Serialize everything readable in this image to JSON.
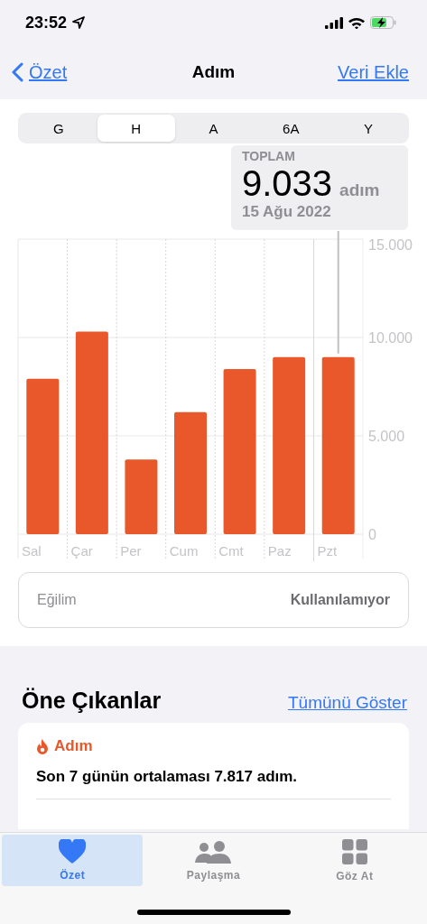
{
  "status_bar": {
    "time": "23:52"
  },
  "nav": {
    "back": "Özet",
    "title": "Adım",
    "action": "Veri Ekle"
  },
  "segments": [
    {
      "label": "G",
      "selected": false
    },
    {
      "label": "H",
      "selected": true
    },
    {
      "label": "A",
      "selected": false
    },
    {
      "label": "6A",
      "selected": false
    },
    {
      "label": "Y",
      "selected": false
    }
  ],
  "chart_data": {
    "type": "bar",
    "categories": [
      "Sal",
      "Çar",
      "Per",
      "Cum",
      "Cmt",
      "Paz",
      "Pzt"
    ],
    "series": [
      {
        "color": "#e8582a",
        "values": [
          7900,
          10300,
          3800,
          6200,
          8400,
          9000,
          9000
        ]
      }
    ],
    "ylim": [
      0,
      15000
    ],
    "yticks": [
      {
        "value": 0,
        "label": "0"
      },
      {
        "value": 5000,
        "label": "5.000"
      },
      {
        "value": 10000,
        "label": "10.000"
      },
      {
        "value": 15000,
        "label": "15.000"
      }
    ]
  },
  "callout": {
    "label": "TOPLAM",
    "value": "9.033",
    "unit": "adım",
    "date": "15 Ağu 2022"
  },
  "trend": {
    "label": "Eğilim",
    "value": "Kullanılamıyor"
  },
  "highlights": {
    "title": "Öne Çıkanlar",
    "link": "Tümünü Göster",
    "card": {
      "category": "Adım",
      "text": "Son 7 günün ortalaması 7.817 adım."
    }
  },
  "tab_bar": [
    {
      "kind": "heart",
      "label": "Özet",
      "selected": true
    },
    {
      "kind": "people",
      "label": "Paylaşma",
      "selected": false
    },
    {
      "kind": "grid",
      "label": "Göz At",
      "selected": false
    }
  ]
}
